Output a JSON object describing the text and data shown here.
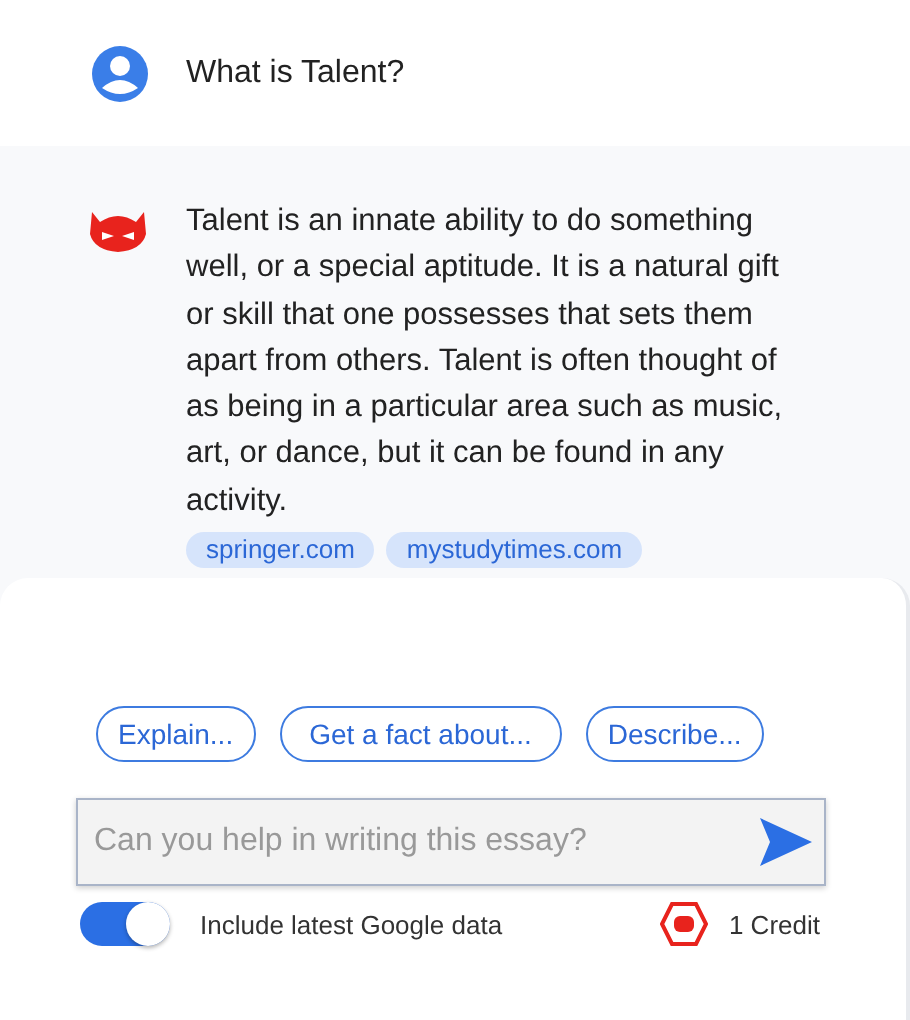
{
  "question": {
    "text": "What is Talent?"
  },
  "answer": {
    "text": "Talent is an innate ability to do something well, or a special aptitude. It is a natural gift or skill that one possesses that sets them apart from others. Talent is often thought of as being in a particular area such as music, art, or dance, but it can be found in any activity.",
    "sources": [
      "springer.com",
      "mystudytimes.com"
    ]
  },
  "suggestions": [
    "Explain...",
    "Get a fact about...",
    "Describe..."
  ],
  "input": {
    "placeholder": "Can you help in writing this essay?"
  },
  "google_toggle": {
    "label": "Include latest Google data",
    "on": true
  },
  "credit": {
    "text": "1 Credit"
  }
}
